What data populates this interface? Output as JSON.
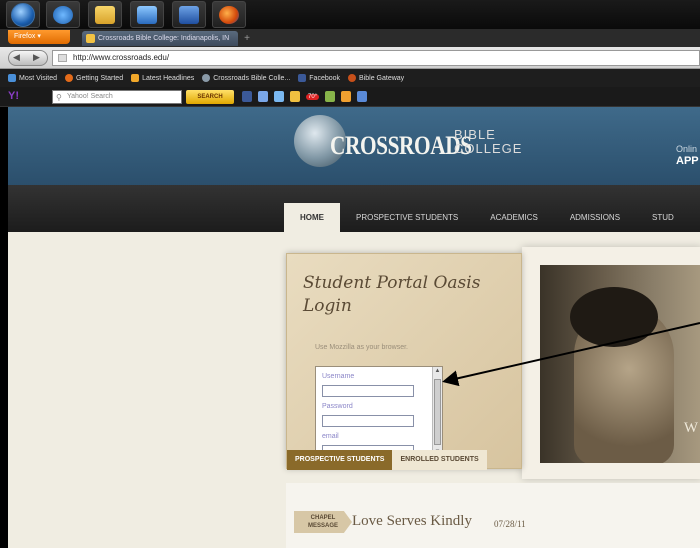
{
  "browser": {
    "firefox_label": "Firefox ▾",
    "tab_title": "Crossroads Bible College: Indianapolis, IN",
    "new_tab": "+",
    "url": "http://www.crossroads.edu/"
  },
  "bookmarks": [
    {
      "label": "Most Visited",
      "color": "#4a90d9"
    },
    {
      "label": "Getting Started",
      "color": "#e46b1a"
    },
    {
      "label": "Latest Headlines",
      "color": "#f2a82a"
    },
    {
      "label": "Crossroads Bible Colle...",
      "color": "#3e4b5c"
    },
    {
      "label": "Facebook",
      "color": "#3b5998"
    },
    {
      "label": "Bible Gateway",
      "color": "#c8501a"
    }
  ],
  "yahoo": {
    "logo": "Y!",
    "search_placeholder": "Yahoo! Search",
    "search_button": "SEARCH",
    "temp": "70°"
  },
  "site": {
    "brand_main": "CROSSROADS",
    "brand_bible": "BIBLE",
    "brand_college": "COLLEGE",
    "online_line1": "Onlin",
    "online_line2": "APP",
    "menu": [
      "HOME",
      "PROSPECTIVE STUDENTS",
      "ACADEMICS",
      "ADMISSIONS",
      "STUD"
    ],
    "portal": {
      "title_line1": "Student Portal Oasis",
      "title_line2": "Login",
      "note": "Use Mozzilla as your browser.",
      "username_label": "Username",
      "password_label": "Password",
      "email_label": "email",
      "tab_prospective": "PROSPECTIVE STUDENTS",
      "tab_enrolled": "ENROLLED STUDENTS"
    },
    "photo_letter": "W",
    "chapel": {
      "badge_line1": "CHAPEL",
      "badge_line2": "MESSAGE",
      "title": "Love Serves Kindly",
      "date": "07/28/11"
    }
  }
}
